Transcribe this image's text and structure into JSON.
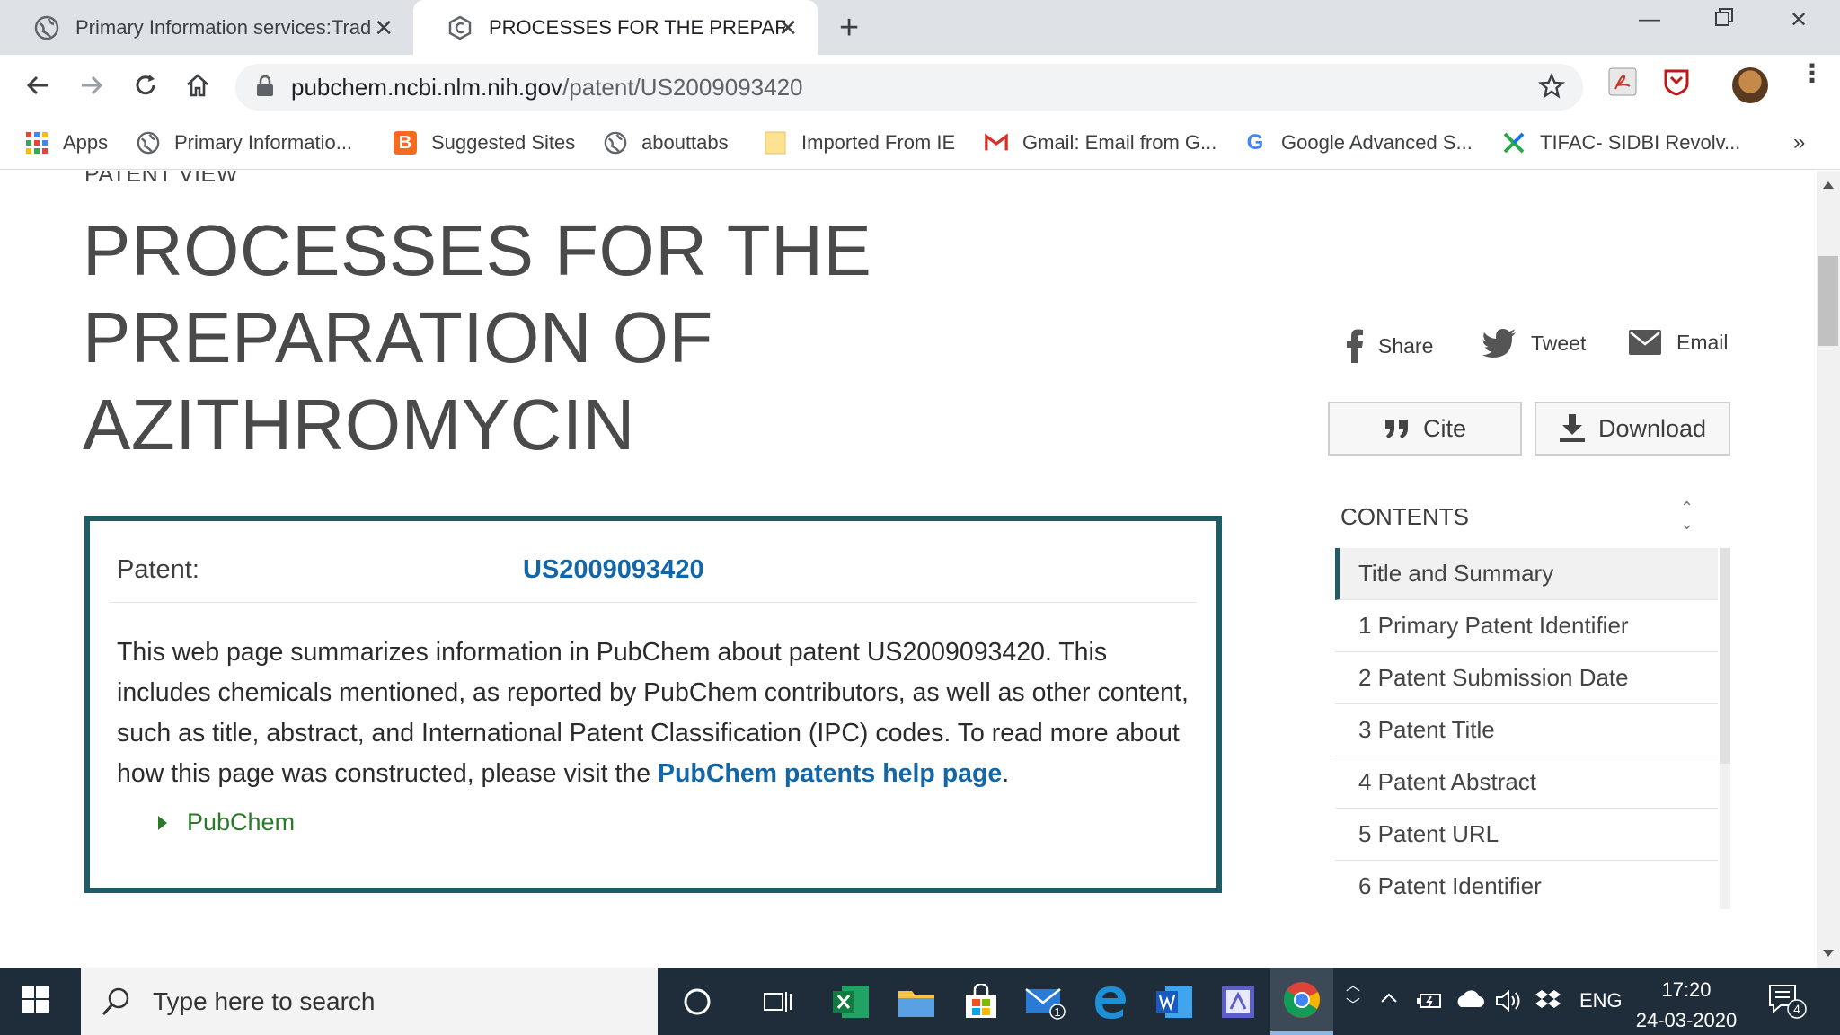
{
  "browser": {
    "tabs": [
      {
        "title": "Primary Information services:Trad",
        "active": false
      },
      {
        "title": "PROCESSES FOR THE PREPARATIO",
        "active": true
      }
    ],
    "url_host": "pubchem.ncbi.nlm.nih.gov",
    "url_path": "/patent/US2009093420",
    "bookmarks": [
      {
        "label": "Apps",
        "icon": "apps-grid-icon"
      },
      {
        "label": "Primary Informatio...",
        "icon": "globe-icon"
      },
      {
        "label": "Suggested Sites",
        "icon": "suggested-sites-icon"
      },
      {
        "label": "abouttabs",
        "icon": "globe-icon"
      },
      {
        "label": "Imported From IE",
        "icon": "folder-icon"
      },
      {
        "label": "Gmail: Email from G...",
        "icon": "gmail-icon"
      },
      {
        "label": "Google Advanced S...",
        "icon": "google-icon"
      },
      {
        "label": "TIFAC- SIDBI Revolv...",
        "icon": "tifac-icon"
      }
    ],
    "bookmarks_overflow": "»"
  },
  "page": {
    "kicker": "PATENT VIEW",
    "title": "PROCESSES FOR THE PREPARATION OF AZITHROMYCIN",
    "share": {
      "facebook": "Share",
      "twitter": "Tweet",
      "email": "Email"
    },
    "buttons": {
      "cite": "Cite",
      "download": "Download"
    },
    "summary": {
      "patent_label": "Patent:",
      "patent_id": "US2009093420",
      "text": "This web page summarizes information in PubChem about patent US2009093420. This includes chemicals mentioned, as reported by PubChem contributors, as well as other content, such as title, abstract, and International Patent Classification (IPC) codes. To read more about how this page was constructed, please visit the ",
      "help_link": "PubChem patents help page",
      "text_end": ".",
      "source": "PubChem"
    },
    "contents": {
      "header": "CONTENTS",
      "items": [
        "Title and Summary",
        "1 Primary Patent Identifier",
        "2 Patent Submission Date",
        "3 Patent Title",
        "4 Patent Abstract",
        "5 Patent URL",
        "6 Patent Identifier"
      ]
    }
  },
  "taskbar": {
    "search_placeholder": "Type here to search",
    "language": "ENG",
    "time": "17:20",
    "date": "24-03-2020",
    "mail_badge": "1",
    "notification_count": "4"
  }
}
